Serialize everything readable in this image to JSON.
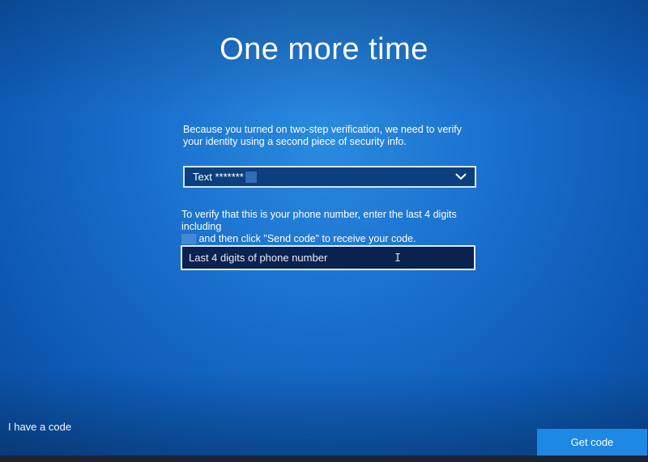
{
  "page": {
    "title": "One more time"
  },
  "verification": {
    "intro_text": "Because you turned on two-step verification, we need to verify your identity using a second piece of security info.",
    "method_dropdown": {
      "selected": "Text *******",
      "chevron_icon": "chevron-down-icon"
    },
    "phone_prompt_line1": "To verify that this is your phone number, enter the last 4 digits including",
    "phone_prompt_line2": "and then click \"Send code\" to receive your code.",
    "digits_input": {
      "placeholder": "Last 4 digits of phone number",
      "value": ""
    }
  },
  "footer": {
    "have_code_link": "I have a code",
    "get_code_button": "Get code"
  },
  "colors": {
    "background": "#1b72cf",
    "dropdown_bg": "#0c3f7e",
    "input_bg": "#0a2250",
    "button_bg": "#1e88e5",
    "text": "#ffffff"
  }
}
